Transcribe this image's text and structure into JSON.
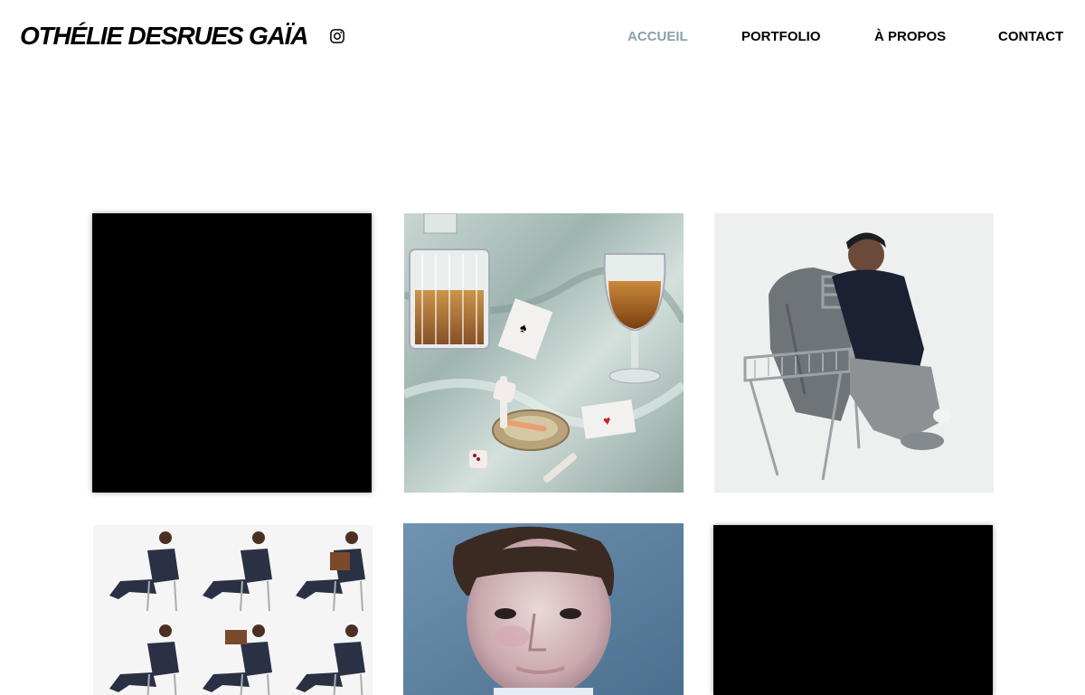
{
  "site": {
    "title": "OTHÉLIE DESRUES GAÏA"
  },
  "social": {
    "icon": "instagram-icon"
  },
  "nav": {
    "items": [
      {
        "label": "ACCUEIL",
        "active": true
      },
      {
        "label": "PORTFOLIO",
        "active": false
      },
      {
        "label": "À PROPOS",
        "active": false
      },
      {
        "label": "CONTACT",
        "active": false
      }
    ]
  },
  "colors": {
    "nav_active": "#8aa0ad",
    "nav_default": "#000000",
    "background": "#ffffff"
  },
  "gallery": {
    "tiles": [
      {
        "kind": "black-video"
      },
      {
        "kind": "still-life-whisky-dice-cards"
      },
      {
        "kind": "model-with-folding-chair"
      },
      {
        "kind": "contact-sheet-seated-model"
      },
      {
        "kind": "portrait-makeup-blue"
      },
      {
        "kind": "black-video"
      }
    ]
  }
}
